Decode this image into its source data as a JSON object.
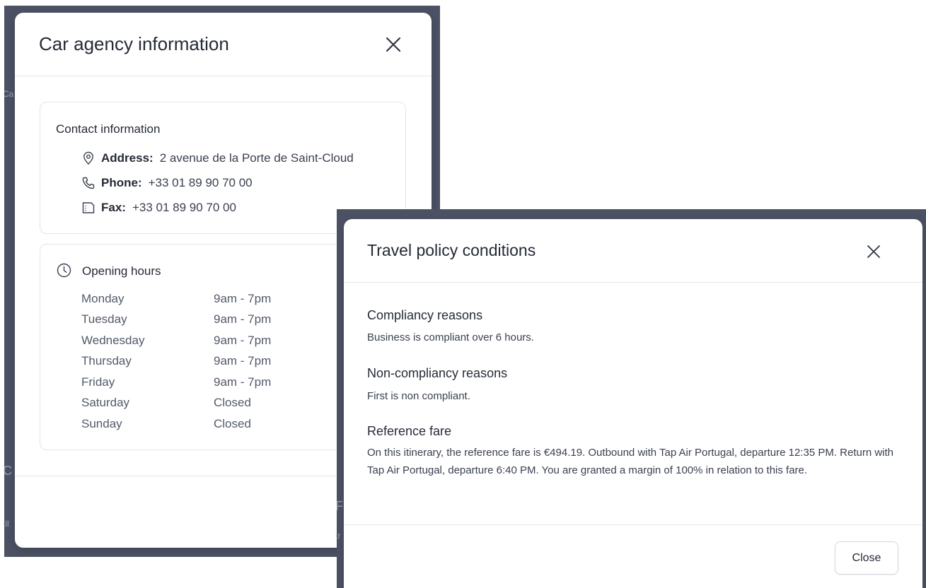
{
  "background": {
    "fragments": [
      "Ca",
      "C",
      "til",
      "F",
      "F",
      "tr"
    ]
  },
  "car_agency_modal": {
    "title": "Car agency information",
    "contact": {
      "title": "Contact information",
      "address_label": "Address:",
      "address_value": "2 avenue de la Porte de Saint-Cloud",
      "phone_label": "Phone:",
      "phone_value": "+33 01 89 90 70 00",
      "fax_label": "Fax:",
      "fax_value": "+33 01 89 90 70 00"
    },
    "hours": {
      "title": "Opening hours",
      "rows": [
        {
          "day": "Monday",
          "time": "9am - 7pm"
        },
        {
          "day": "Tuesday",
          "time": "9am - 7pm"
        },
        {
          "day": "Wednesday",
          "time": "9am - 7pm"
        },
        {
          "day": "Thursday",
          "time": "9am - 7pm"
        },
        {
          "day": "Friday",
          "time": "9am - 7pm"
        },
        {
          "day": "Saturday",
          "time": "Closed"
        },
        {
          "day": "Sunday",
          "time": "Closed"
        }
      ]
    }
  },
  "travel_policy_modal": {
    "title": "Travel policy conditions",
    "compliancy_title": "Compliancy reasons",
    "compliancy_text": "Business is compliant over 6 hours.",
    "non_compliancy_title": "Non-compliancy reasons",
    "non_compliancy_text": "First is non compliant.",
    "reference_title": "Reference fare",
    "reference_text": "On this itinerary, the reference fare is €494.19. Outbound with Tap Air Portugal, departure 12:35 PM. Return with Tap Air Portugal, departure 6:40 PM. You are granted a margin of 100% in relation to this fare.",
    "close_label": "Close"
  },
  "icons": {
    "close": "close-icon",
    "location": "location-pin-icon",
    "phone": "phone-icon",
    "fax": "fax-icon",
    "clock": "clock-icon"
  },
  "colors": {
    "overlay": "#4c5264",
    "text": "#252a36",
    "border": "#e3e5ea"
  }
}
